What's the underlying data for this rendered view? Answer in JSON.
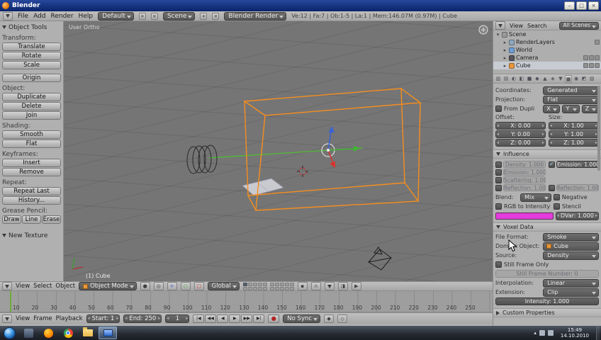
{
  "titlebar": {
    "title": "Blender",
    "controls": [
      "–",
      "□",
      "×"
    ]
  },
  "infobar": {
    "menus": [
      "File",
      "Add",
      "Render",
      "Help"
    ],
    "layout": "Default",
    "scene": "Scene",
    "engine": "Blender Render",
    "stats": "Ve:12 | Fa:7 | Ob:1-5 | La:1 | Mem:146.07M (0.97M) | Cube"
  },
  "tool_shelf": {
    "title": "Object Tools",
    "groups": [
      {
        "label": "Transform:",
        "buttons": [
          "Translate",
          "Rotate",
          "Scale"
        ]
      },
      {
        "label": "",
        "buttons": [
          "Origin"
        ]
      },
      {
        "label": "Object:",
        "buttons": [
          "Duplicate",
          "Delete",
          "Join"
        ]
      },
      {
        "label": "Shading:",
        "buttons": [
          "Smooth",
          "Flat"
        ]
      },
      {
        "label": "Keyframes:",
        "buttons": [
          "Insert",
          "Remove"
        ]
      },
      {
        "label": "Repeat:",
        "buttons": [
          "Repeat Last",
          "History..."
        ]
      },
      {
        "label": "Grease Pencil:",
        "inline": true,
        "buttons": [
          "Draw",
          "Line",
          "Erase"
        ]
      }
    ],
    "extra_panel": "New Texture"
  },
  "viewport": {
    "view_label": "User Ortho",
    "object_label": "(1) Cube",
    "header": {
      "menus": [
        "View",
        "Select",
        "Object"
      ],
      "mode": "Object Mode",
      "orientation": "Global",
      "active_layer": 0
    }
  },
  "timeline": {
    "ruler_numbers": [
      10,
      20,
      30,
      40,
      50,
      60,
      70,
      80,
      90,
      100,
      110,
      120,
      130,
      140,
      150,
      160,
      170,
      180,
      190,
      200,
      210,
      220,
      230,
      240,
      250
    ],
    "menus": [
      "View",
      "Frame",
      "Playback"
    ],
    "start": "Start: 1",
    "end": "End: 250",
    "current_frame": "1",
    "playback_buttons": [
      "|◀",
      "◀◀",
      "◀",
      "▶",
      "▶▶",
      "▶|"
    ],
    "sync": "No Sync"
  },
  "outliner": {
    "menus": [
      "View",
      "Search"
    ],
    "scope": "All Scenes",
    "items": [
      {
        "label": "Scene",
        "depth": 0,
        "expanded": true,
        "icon": "scene",
        "icon_color": "#9a9a9a"
      },
      {
        "label": "RenderLayers",
        "depth": 1,
        "expanded": false,
        "icon": "render-layers",
        "icon_color": "#8fa8bf",
        "right_icons": [
          "render"
        ]
      },
      {
        "label": "World",
        "depth": 1,
        "expanded": false,
        "icon": "world",
        "icon_color": "#6f9fd6"
      },
      {
        "label": "Camera",
        "depth": 1,
        "expanded": false,
        "icon": "camera",
        "icon_color": "#55555f",
        "right_icons": [
          "visibility",
          "selectability",
          "renderability"
        ]
      },
      {
        "label": "Cube",
        "depth": 1,
        "expanded": false,
        "icon": "mesh",
        "icon_color": "#e8973d",
        "selected": true,
        "right_icons": [
          "visibility",
          "selectability",
          "renderability"
        ]
      }
    ]
  },
  "properties": {
    "tabs": {
      "glyphs": [
        "▥",
        "▤",
        "◐",
        "◧",
        "■",
        "◆",
        "▲",
        "◈",
        "▼",
        "▦",
        "◉",
        "◩",
        "▧"
      ],
      "active_index": 9
    },
    "mapping": {
      "coordinates_label": "Coordinates:",
      "coordinates": "Generated",
      "projection_label": "Projection:",
      "projection": "Flat",
      "from_dupli": "From Dupli",
      "axes": [
        "X",
        "Y",
        "Z"
      ],
      "offset_label": "Offset:",
      "size_label": "Size:",
      "offset": [
        "X: 0.00",
        "Y: 0.00",
        "Z: 0.00"
      ],
      "size": [
        "X: 1.00",
        "Y: 1.00",
        "Z: 1.00"
      ]
    },
    "influence": {
      "title": "Influence",
      "left": [
        {
          "label": "Density:",
          "value": "1.000",
          "checked": false,
          "active": false
        },
        {
          "label": "Emission:",
          "value": "1.000",
          "checked": false,
          "active": false
        },
        {
          "label": "Scattering:",
          "value": "1.000",
          "checked": false,
          "active": false
        },
        {
          "label": "Reflection:",
          "value": "1.000",
          "checked": false,
          "active": false
        }
      ],
      "right": [
        {
          "label": "Emission:",
          "value": "1.000",
          "checked": true,
          "active": true
        },
        null,
        null,
        {
          "label": "Reflection:",
          "value": "1.000",
          "checked": false,
          "active": false
        }
      ],
      "blend_label": "Blend:",
      "blend": "Mix",
      "negative": "Negative",
      "rgb_to_intensity": "RGB to Intensity",
      "stencil": "Stencil",
      "swatch_color": "#e43bdc",
      "dvar": "DVar: 1.000"
    },
    "voxel_data": {
      "title": "Voxel Data",
      "file_format_label": "File Format:",
      "file_format": "Smoke",
      "domain_label": "Domain Object:",
      "domain": "Cube",
      "source_label": "Source:",
      "source": "Density",
      "still_frame_only": "Still Frame Only",
      "still_frame_number": "Still Frame Number: 0",
      "interpolation_label": "Interpolation:",
      "interpolation": "Linear",
      "extension_label": "Extension:",
      "extension": "Clip",
      "intensity": "Intensity: 1.000"
    },
    "custom_properties": "Custom Properties"
  },
  "taskbar": {
    "time": "15:49",
    "date": "14.10.2010"
  },
  "colors": {
    "selection_orange": "#f68e1e",
    "axis_green": "#4cc22e",
    "magenta_swatch": "#e43bdc"
  }
}
